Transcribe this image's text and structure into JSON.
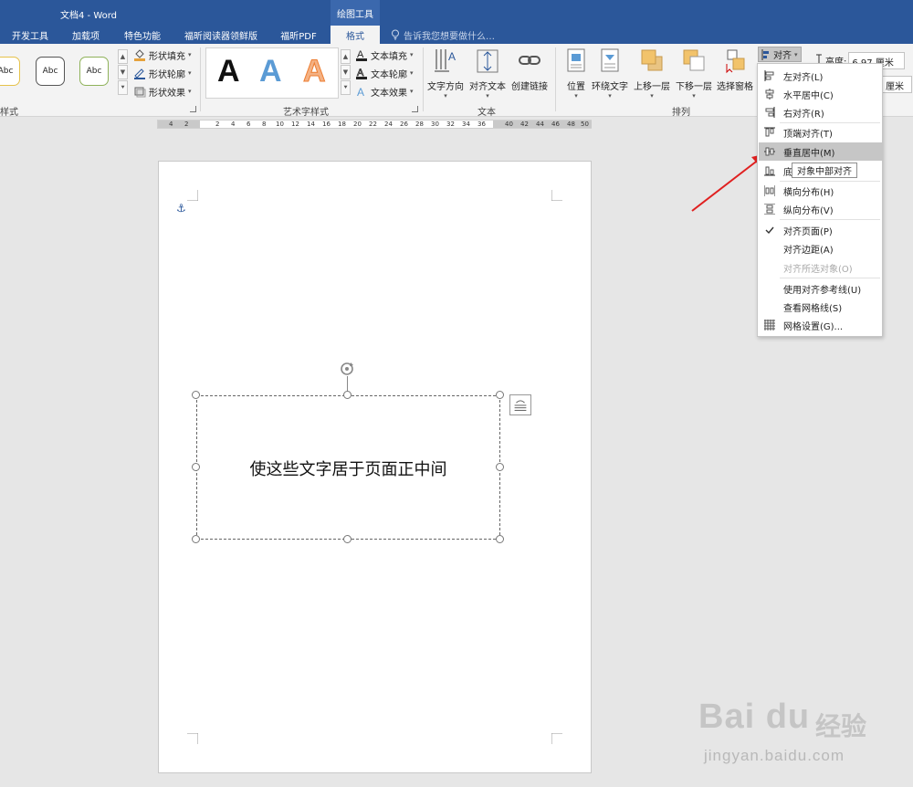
{
  "title_bar": {
    "title": "文档4 - Word",
    "contextual_header": "绘图工具"
  },
  "tabs": [
    "开发工具",
    "加载项",
    "特色功能",
    "福昕阅读器领鲜版",
    "福昕PDF",
    "格式"
  ],
  "tell_me": "告诉我您想要做什么…",
  "ribbon": {
    "shape_styles": {
      "group_label": "样式",
      "swatches": [
        "Abc",
        "Abc",
        "Abc"
      ],
      "fill": "形状填充",
      "outline": "形状轮廓",
      "effects": "形状效果"
    },
    "wordart": {
      "group_label": "艺术字样式",
      "letters": [
        "A",
        "A",
        "A"
      ],
      "fill": "文本填充",
      "outline": "文本轮廓",
      "effects": "文本效果"
    },
    "text": {
      "group_label": "文本",
      "direction": "文字方向",
      "align_text": "对齐文本",
      "create_link": "创建链接"
    },
    "arrange": {
      "group_label": "排列",
      "position": "位置",
      "wrap": "环绕文字",
      "bring_forward": "上移一层",
      "send_backward": "下移一层",
      "selection_pane": "选择窗格",
      "align": "对齐"
    },
    "size": {
      "height_label": "高度:",
      "height_value": "6.97 厘米",
      "width_value": "厘米"
    }
  },
  "ruler": {
    "ticks": [
      "4",
      "2",
      "2",
      "4",
      "6",
      "8",
      "10",
      "12",
      "14",
      "16",
      "18",
      "20",
      "22",
      "24",
      "26",
      "28",
      "30",
      "32",
      "34",
      "36",
      "40",
      "42",
      "44",
      "46",
      "48",
      "50"
    ]
  },
  "document": {
    "textbox_text": "使这些文字居于页面正中间"
  },
  "align_menu": {
    "items": [
      {
        "label": "左对齐(L)",
        "icon": "align-left-icon"
      },
      {
        "label": "水平居中(C)",
        "icon": "align-center-icon"
      },
      {
        "label": "右对齐(R)",
        "icon": "align-right-icon"
      },
      {
        "label": "顶端对齐(T)",
        "icon": "align-top-icon"
      },
      {
        "label": "垂直居中(M)",
        "icon": "align-middle-icon"
      },
      {
        "label": "底",
        "icon": "align-bottom-icon"
      },
      {
        "label": "横向分布(H)",
        "icon": "distribute-horizontal-icon"
      },
      {
        "label": "纵向分布(V)",
        "icon": "distribute-vertical-icon"
      },
      {
        "label": "对齐页面(P)",
        "icon": "checkmark-icon"
      },
      {
        "label": "对齐边距(A)",
        "icon": ""
      },
      {
        "label": "对齐所选对象(O)",
        "icon": ""
      },
      {
        "label": "使用对齐参考线(U)",
        "icon": ""
      },
      {
        "label": "查看网格线(S)",
        "icon": ""
      },
      {
        "label": "网格设置(G)...",
        "icon": "grid-icon"
      }
    ],
    "tooltip": "对象中部对齐",
    "highlighted": "垂直居中(M)",
    "disabled": "对齐所选对象(O)"
  },
  "annotation": {
    "arrow_color": "#e02020"
  },
  "watermark": {
    "logo": "Bai du",
    "brand": "经验",
    "url": "jingyan.baidu.com"
  },
  "colors": {
    "accent": "#2b579a",
    "ribbon_bg": "#f3f3f3",
    "wordart_blue": "#5b9bd5",
    "wordart_orange": "#f4b183"
  }
}
